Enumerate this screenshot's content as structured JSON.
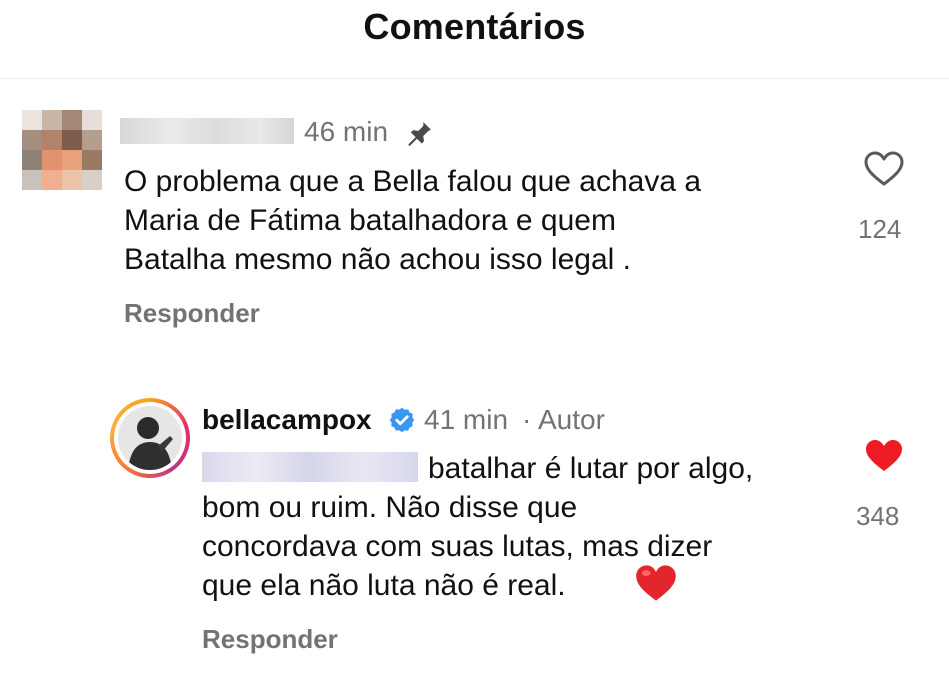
{
  "header": {
    "title": "Comentários"
  },
  "comments": [
    {
      "username_hidden": true,
      "time": "46 min",
      "pinned": true,
      "lines": [
        "O problema que a Bella falou que achava a",
        "Maria de Fátima batalhadora e quem",
        "Batalha mesmo não achou isso legal ."
      ],
      "reply_label": "Responder",
      "likes": "124",
      "liked": false,
      "heart_icon": "heart-outline-icon"
    },
    {
      "username": "bellacampox",
      "verified": true,
      "time": "41 min",
      "separator": "·",
      "author_label": "Autor",
      "mention_hidden": true,
      "lines": [
        "batalhar é lutar por algo,",
        "bom ou ruim. Não disse que",
        "concordava com suas lutas, mas dizer",
        "que ela não luta não é real."
      ],
      "emoji": "red-heart-emoji",
      "reply_label": "Responder",
      "likes": "348",
      "liked": true,
      "heart_icon": "heart-filled-icon",
      "colors": {
        "like": "#ed1c24",
        "verified": "#3897f0"
      }
    }
  ]
}
